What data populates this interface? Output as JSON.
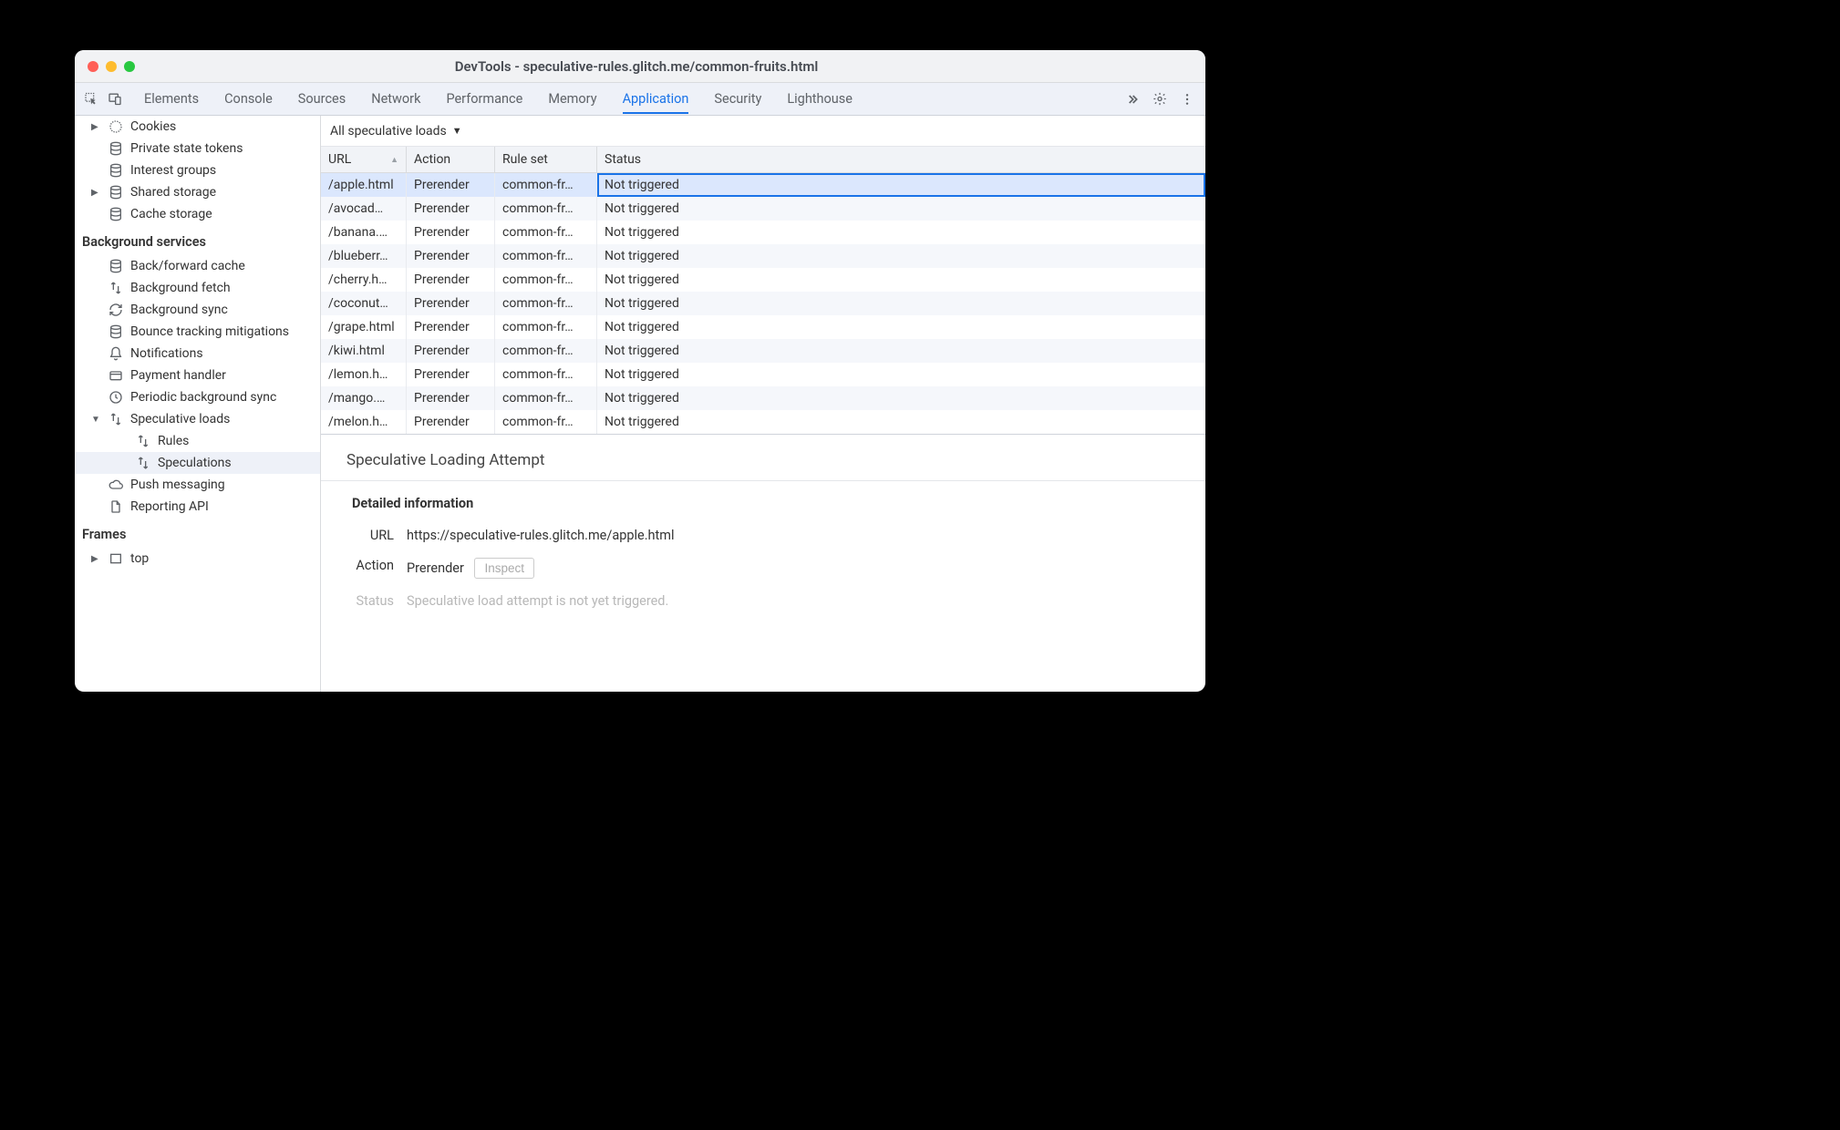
{
  "window_title": "DevTools - speculative-rules.glitch.me/common-fruits.html",
  "tabs": [
    "Elements",
    "Console",
    "Sources",
    "Network",
    "Performance",
    "Memory",
    "Application",
    "Security",
    "Lighthouse"
  ],
  "active_tab": "Application",
  "sidebar": {
    "storage": [
      {
        "label": "Cookies",
        "icon": "cookies",
        "exp": true
      },
      {
        "label": "Private state tokens",
        "icon": "db"
      },
      {
        "label": "Interest groups",
        "icon": "db"
      },
      {
        "label": "Shared storage",
        "icon": "db",
        "exp": true
      },
      {
        "label": "Cache storage",
        "icon": "db"
      }
    ],
    "bg_header": "Background services",
    "bg": [
      {
        "label": "Back/forward cache",
        "icon": "db"
      },
      {
        "label": "Background fetch",
        "icon": "fetch"
      },
      {
        "label": "Background sync",
        "icon": "sync"
      },
      {
        "label": "Bounce tracking mitigations",
        "icon": "db"
      },
      {
        "label": "Notifications",
        "icon": "bell"
      },
      {
        "label": "Payment handler",
        "icon": "card"
      },
      {
        "label": "Periodic background sync",
        "icon": "clock"
      },
      {
        "label": "Speculative loads",
        "icon": "fetch",
        "exp": true,
        "open": true,
        "children": [
          {
            "label": "Rules",
            "icon": "fetch"
          },
          {
            "label": "Speculations",
            "icon": "fetch",
            "selected": true
          }
        ]
      },
      {
        "label": "Push messaging",
        "icon": "cloud"
      },
      {
        "label": "Reporting API",
        "icon": "file"
      }
    ],
    "frames_header": "Frames",
    "frames": [
      {
        "label": "top",
        "icon": "frame",
        "exp": true
      }
    ]
  },
  "filter_label": "All speculative loads",
  "columns": [
    "URL",
    "Action",
    "Rule set",
    "Status"
  ],
  "rows": [
    {
      "url": "/apple.html",
      "action": "Prerender",
      "rule": "common-fr…",
      "status": "Not triggered",
      "selected": true
    },
    {
      "url": "/avocad…",
      "action": "Prerender",
      "rule": "common-fr…",
      "status": "Not triggered"
    },
    {
      "url": "/banana.…",
      "action": "Prerender",
      "rule": "common-fr…",
      "status": "Not triggered"
    },
    {
      "url": "/blueberr…",
      "action": "Prerender",
      "rule": "common-fr…",
      "status": "Not triggered"
    },
    {
      "url": "/cherry.h…",
      "action": "Prerender",
      "rule": "common-fr…",
      "status": "Not triggered"
    },
    {
      "url": "/coconut…",
      "action": "Prerender",
      "rule": "common-fr…",
      "status": "Not triggered"
    },
    {
      "url": "/grape.html",
      "action": "Prerender",
      "rule": "common-fr…",
      "status": "Not triggered"
    },
    {
      "url": "/kiwi.html",
      "action": "Prerender",
      "rule": "common-fr…",
      "status": "Not triggered"
    },
    {
      "url": "/lemon.h…",
      "action": "Prerender",
      "rule": "common-fr…",
      "status": "Not triggered"
    },
    {
      "url": "/mango.…",
      "action": "Prerender",
      "rule": "common-fr…",
      "status": "Not triggered"
    },
    {
      "url": "/melon.h…",
      "action": "Prerender",
      "rule": "common-fr…",
      "status": "Not triggered"
    }
  ],
  "details": {
    "heading": "Speculative Loading Attempt",
    "section": "Detailed information",
    "url_k": "URL",
    "url_v": "https://speculative-rules.glitch.me/apple.html",
    "action_k": "Action",
    "action_v": "Prerender",
    "inspect": "Inspect",
    "status_k": "Status",
    "status_v": "Speculative load attempt is not yet triggered."
  }
}
